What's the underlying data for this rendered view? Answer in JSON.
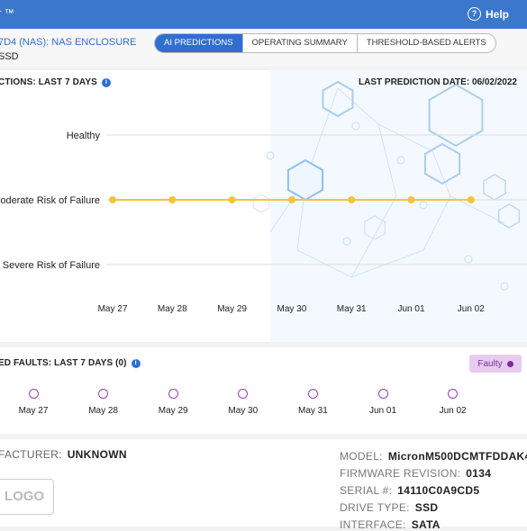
{
  "header": {
    "brand": "r ™",
    "help_label": "Help",
    "help_icon": "help-circle-icon"
  },
  "device": {
    "line1": "7D4 (NAS):  NAS ENCLOSURE",
    "line2": "SSD"
  },
  "tabs": [
    {
      "label": "AI PREDICTIONS",
      "active": true
    },
    {
      "label": "OPERATING SUMMARY",
      "active": false
    },
    {
      "label": "THRESHOLD-BASED ALERTS",
      "active": false
    }
  ],
  "predictions": {
    "title": "CTIONS: LAST 7 DAYS",
    "last_prediction": "LAST PREDICTION DATE: 06/02/2022",
    "accent_color": "#f3c43c"
  },
  "chart_data": {
    "type": "line",
    "title": "",
    "categories": [
      "May 27",
      "May 28",
      "May 29",
      "May 30",
      "May 31",
      "Jun 01",
      "Jun 02"
    ],
    "y_levels": [
      "Healthy",
      "oderate Risk of Failure",
      "Severe Risk of Failure"
    ],
    "series": [
      {
        "values": [
          "oderate Risk of Failure",
          "oderate Risk of Failure",
          "oderate Risk of Failure",
          "oderate Risk of Failure",
          "oderate Risk of Failure",
          "oderate Risk of Failure",
          "oderate Risk of Failure"
        ]
      }
    ],
    "grid": true
  },
  "faults": {
    "title": "ED FAULTS: LAST 7 DAYS (0)",
    "badge_label": "Faulty",
    "badge_color": "#7b2f9a",
    "days": [
      "May 27",
      "May 28",
      "May 29",
      "May 30",
      "May 31",
      "Jun 01",
      "Jun 02"
    ]
  },
  "drive": {
    "manufacturer_label": "FACTURER:",
    "manufacturer_value": "UNKNOWN",
    "logo_text": "LOGO",
    "model_label": "MODEL:",
    "model_value": "MicronM500DCMTFDDAK4",
    "firmware_label": "FIRMWARE REVISION:",
    "firmware_value": "0134",
    "serial_label": "SERIAL #:",
    "serial_value": "14110C0A9CD5",
    "drive_type_label": "DRIVE TYPE:",
    "drive_type_value": "SSD",
    "interface_label": "INTERFACE:",
    "interface_value": "SATA"
  }
}
